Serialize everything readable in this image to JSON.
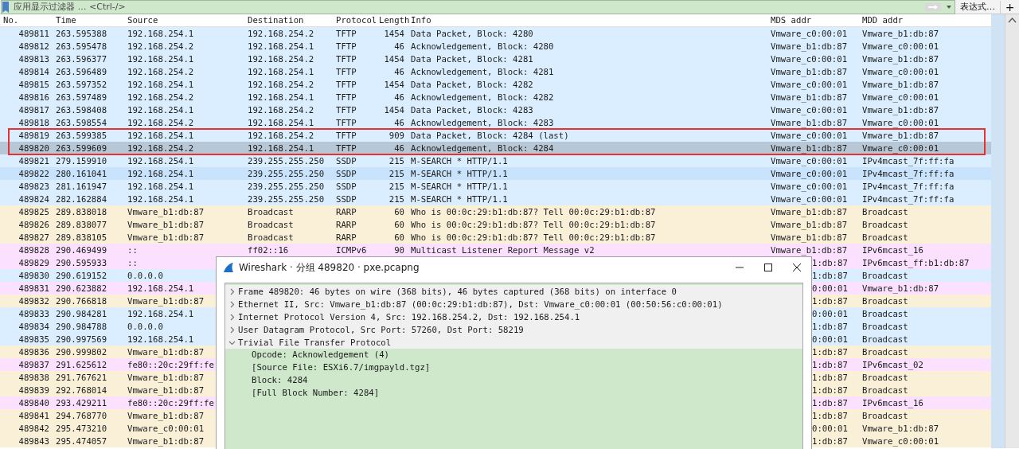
{
  "filter_bar": {
    "placeholder": "应用显示过滤器 … <Ctrl-/>",
    "buttons": [
      {
        "label": "表达式…",
        "kind": "expression"
      },
      {
        "label": "+",
        "kind": "add"
      }
    ]
  },
  "packet_list": {
    "columns": [
      "No.",
      "Time",
      "Source",
      "Destination",
      "Protocol",
      "Length",
      "Info",
      "MDS addr",
      "MDD addr"
    ],
    "rows": [
      {
        "kind": "full",
        "no": "489811",
        "time": "263.595388",
        "source": "192.168.254.1",
        "destination": "192.168.254.2",
        "protocol": "TFTP",
        "length": "1454",
        "info": "Data Packet, Block: 4280",
        "mds_addr": "Vmware_c0:00:01",
        "mdd_addr": "Vmware_b1:db:87",
        "color": "#daeeff",
        "selected": false,
        "marked": false
      },
      {
        "kind": "full",
        "no": "489812",
        "time": "263.595478",
        "source": "192.168.254.2",
        "destination": "192.168.254.1",
        "protocol": "TFTP",
        "length": "46",
        "info": "Acknowledgement, Block: 4280",
        "mds_addr": "Vmware_b1:db:87",
        "mdd_addr": "Vmware_c0:00:01",
        "color": "#daeeff",
        "selected": false,
        "marked": false
      },
      {
        "kind": "full",
        "no": "489813",
        "time": "263.596377",
        "source": "192.168.254.1",
        "destination": "192.168.254.2",
        "protocol": "TFTP",
        "length": "1454",
        "info": "Data Packet, Block: 4281",
        "mds_addr": "Vmware_c0:00:01",
        "mdd_addr": "Vmware_b1:db:87",
        "color": "#daeeff",
        "selected": false,
        "marked": false
      },
      {
        "kind": "full",
        "no": "489814",
        "time": "263.596489",
        "source": "192.168.254.2",
        "destination": "192.168.254.1",
        "protocol": "TFTP",
        "length": "46",
        "info": "Acknowledgement, Block: 4281",
        "mds_addr": "Vmware_b1:db:87",
        "mdd_addr": "Vmware_c0:00:01",
        "color": "#daeeff",
        "selected": false,
        "marked": false
      },
      {
        "kind": "full",
        "no": "489815",
        "time": "263.597352",
        "source": "192.168.254.1",
        "destination": "192.168.254.2",
        "protocol": "TFTP",
        "length": "1454",
        "info": "Data Packet, Block: 4282",
        "mds_addr": "Vmware_c0:00:01",
        "mdd_addr": "Vmware_b1:db:87",
        "color": "#daeeff",
        "selected": false,
        "marked": false
      },
      {
        "kind": "full",
        "no": "489816",
        "time": "263.597489",
        "source": "192.168.254.2",
        "destination": "192.168.254.1",
        "protocol": "TFTP",
        "length": "46",
        "info": "Acknowledgement, Block: 4282",
        "mds_addr": "Vmware_b1:db:87",
        "mdd_addr": "Vmware_c0:00:01",
        "color": "#daeeff",
        "selected": false,
        "marked": false
      },
      {
        "kind": "full",
        "no": "489817",
        "time": "263.598408",
        "source": "192.168.254.1",
        "destination": "192.168.254.2",
        "protocol": "TFTP",
        "length": "1454",
        "info": "Data Packet, Block: 4283",
        "mds_addr": "Vmware_c0:00:01",
        "mdd_addr": "Vmware_b1:db:87",
        "color": "#daeeff",
        "selected": false,
        "marked": false
      },
      {
        "kind": "full",
        "no": "489818",
        "time": "263.598554",
        "source": "192.168.254.2",
        "destination": "192.168.254.1",
        "protocol": "TFTP",
        "length": "46",
        "info": "Acknowledgement, Block: 4283",
        "mds_addr": "Vmware_b1:db:87",
        "mdd_addr": "Vmware_c0:00:01",
        "color": "#daeeff",
        "selected": false,
        "marked": false
      },
      {
        "kind": "full",
        "no": "489819",
        "time": "263.599385",
        "source": "192.168.254.1",
        "destination": "192.168.254.2",
        "protocol": "TFTP",
        "length": "909",
        "info": "Data Packet, Block: 4284 (last)",
        "mds_addr": "Vmware_c0:00:01",
        "mdd_addr": "Vmware_b1:db:87",
        "color": "#daeeff",
        "selected": false,
        "marked": true
      },
      {
        "kind": "full",
        "no": "489820",
        "time": "263.599609",
        "source": "192.168.254.2",
        "destination": "192.168.254.1",
        "protocol": "TFTP",
        "length": "46",
        "info": "Acknowledgement, Block: 4284",
        "mds_addr": "Vmware_b1:db:87",
        "mdd_addr": "Vmware_c0:00:01",
        "selected": true,
        "marked": true
      },
      {
        "kind": "full",
        "no": "489821",
        "time": "279.159910",
        "source": "192.168.254.1",
        "destination": "239.255.255.250",
        "protocol": "SSDP",
        "length": "215",
        "info": "M-SEARCH * HTTP/1.1",
        "mds_addr": "Vmware_c0:00:01",
        "mdd_addr": "IPv4mcast_7f:ff:fa",
        "color": "#daeeff",
        "selected": false,
        "marked": false
      },
      {
        "kind": "full",
        "no": "489822",
        "time": "280.161041",
        "source": "192.168.254.1",
        "destination": "239.255.255.250",
        "protocol": "SSDP",
        "length": "215",
        "info": "M-SEARCH * HTTP/1.1",
        "mds_addr": "Vmware_c0:00:01",
        "mdd_addr": "IPv4mcast_7f:ff:fa",
        "color": "#c8e3fb",
        "selected": false,
        "marked": false
      },
      {
        "kind": "full",
        "no": "489823",
        "time": "281.161947",
        "source": "192.168.254.1",
        "destination": "239.255.255.250",
        "protocol": "SSDP",
        "length": "215",
        "info": "M-SEARCH * HTTP/1.1",
        "mds_addr": "Vmware_c0:00:01",
        "mdd_addr": "IPv4mcast_7f:ff:fa",
        "color": "#daeeff",
        "selected": false,
        "marked": false
      },
      {
        "kind": "full",
        "no": "489824",
        "time": "282.162884",
        "source": "192.168.254.1",
        "destination": "239.255.255.250",
        "protocol": "SSDP",
        "length": "215",
        "info": "M-SEARCH * HTTP/1.1",
        "mds_addr": "Vmware_c0:00:01",
        "mdd_addr": "IPv4mcast_7f:ff:fa",
        "color": "#daeeff",
        "selected": false,
        "marked": false
      },
      {
        "kind": "full",
        "no": "489825",
        "time": "289.838018",
        "source": "Vmware_b1:db:87",
        "destination": "Broadcast",
        "protocol": "RARP",
        "length": "60",
        "info": "Who is 00:0c:29:b1:db:87? Tell 00:0c:29:b1:db:87",
        "mds_addr": "Vmware_b1:db:87",
        "mdd_addr": "Broadcast",
        "color": "#faf0d7",
        "selected": false,
        "marked": false
      },
      {
        "kind": "full",
        "no": "489826",
        "time": "289.838077",
        "source": "Vmware_b1:db:87",
        "destination": "Broadcast",
        "protocol": "RARP",
        "length": "60",
        "info": "Who is 00:0c:29:b1:db:87? Tell 00:0c:29:b1:db:87",
        "mds_addr": "Vmware_b1:db:87",
        "mdd_addr": "Broadcast",
        "color": "#faf0d7",
        "selected": false,
        "marked": false
      },
      {
        "kind": "full",
        "no": "489827",
        "time": "289.838105",
        "source": "Vmware_b1:db:87",
        "destination": "Broadcast",
        "protocol": "RARP",
        "length": "60",
        "info": "Who is 00:0c:29:b1:db:87? Tell 00:0c:29:b1:db:87",
        "mds_addr": "Vmware_b1:db:87",
        "mdd_addr": "Broadcast",
        "color": "#faf0d7",
        "selected": false,
        "marked": false
      },
      {
        "kind": "full",
        "no": "489828",
        "time": "290.469499",
        "source": "::",
        "destination": "ff02::16",
        "protocol": "ICMPv6",
        "length": "90",
        "info": "Multicast Listener Report Message v2",
        "mds_addr": "Vmware_b1:db:87",
        "mdd_addr": "IPv6mcast_16",
        "color": "#fce0ff",
        "selected": false,
        "marked": false
      },
      {
        "kind": "covered",
        "no": "489829",
        "time": "290.595933",
        "source": "::",
        "mds_addr": "1:db:87",
        "mdd_addr": "IPv6mcast_ff:b1:db:87",
        "color": "#fce0ff",
        "selected": false,
        "marked": false
      },
      {
        "kind": "covered",
        "no": "489830",
        "time": "290.619152",
        "source": "0.0.0.0",
        "mds_addr": "1:db:87",
        "mdd_addr": "Broadcast",
        "color": "#daeeff",
        "selected": false,
        "marked": false
      },
      {
        "kind": "covered",
        "no": "489831",
        "time": "290.623882",
        "source": "192.168.254.1",
        "mds_addr": "0:00:01",
        "mdd_addr": "Vmware_b1:db:87",
        "color": "#fce0ff",
        "selected": false,
        "marked": false
      },
      {
        "kind": "covered",
        "no": "489832",
        "time": "290.766818",
        "source": "Vmware_b1:db:87",
        "mds_addr": "1:db:87",
        "mdd_addr": "Broadcast",
        "color": "#faf0d7",
        "selected": false,
        "marked": false
      },
      {
        "kind": "covered",
        "no": "489833",
        "time": "290.984281",
        "source": "192.168.254.1",
        "mds_addr": "0:00:01",
        "mdd_addr": "Broadcast",
        "color": "#daeeff",
        "selected": false,
        "marked": false
      },
      {
        "kind": "covered",
        "no": "489834",
        "time": "290.984788",
        "source": "0.0.0.0",
        "mds_addr": "1:db:87",
        "mdd_addr": "Broadcast",
        "color": "#daeeff",
        "selected": false,
        "marked": false
      },
      {
        "kind": "covered",
        "no": "489835",
        "time": "290.997569",
        "source": "192.168.254.1",
        "mds_addr": "0:00:01",
        "mdd_addr": "Broadcast",
        "color": "#daeeff",
        "selected": false,
        "marked": false
      },
      {
        "kind": "covered",
        "no": "489836",
        "time": "290.999802",
        "source": "Vmware_b1:db:87",
        "mds_addr": "1:db:87",
        "mdd_addr": "Broadcast",
        "color": "#faf0d7",
        "selected": false,
        "marked": false
      },
      {
        "kind": "covered",
        "no": "489837",
        "time": "291.625612",
        "source": "fe80::20c:29ff:fe",
        "mds_addr": "1:db:87",
        "mdd_addr": "IPv6mcast_02",
        "color": "#fce0ff",
        "selected": false,
        "marked": false
      },
      {
        "kind": "covered",
        "no": "489838",
        "time": "291.767621",
        "source": "Vmware_b1:db:87",
        "mds_addr": "1:db:87",
        "mdd_addr": "Broadcast",
        "color": "#faf0d7",
        "selected": false,
        "marked": false
      },
      {
        "kind": "covered",
        "no": "489839",
        "time": "292.768014",
        "source": "Vmware_b1:db:87",
        "mds_addr": "1:db:87",
        "mdd_addr": "Broadcast",
        "color": "#faf0d7",
        "selected": false,
        "marked": false
      },
      {
        "kind": "covered",
        "no": "489840",
        "time": "293.429211",
        "source": "fe80::20c:29ff:fe",
        "mds_addr": "1:db:87",
        "mdd_addr": "IPv6mcast_16",
        "color": "#fce0ff",
        "selected": false,
        "marked": false
      },
      {
        "kind": "covered",
        "no": "489841",
        "time": "294.768770",
        "source": "Vmware_b1:db:87",
        "mds_addr": "1:db:87",
        "mdd_addr": "Broadcast",
        "color": "#faf0d7",
        "selected": false,
        "marked": false
      },
      {
        "kind": "covered",
        "no": "489842",
        "time": "295.473210",
        "source": "Vmware_c0:00:01",
        "mds_addr": "0:00:01",
        "mdd_addr": "Vmware_b1:db:87",
        "color": "#faf0d7",
        "selected": false,
        "marked": false
      },
      {
        "kind": "covered",
        "no": "489843",
        "time": "295.474057",
        "source": "Vmware_b1:db:87",
        "mds_addr": "1:db:87",
        "mdd_addr": "Vmware_c0:00:01",
        "color": "#faf0d7",
        "selected": false,
        "marked": false
      }
    ]
  },
  "packet_dialog": {
    "title": "Wireshark · 分组 489820 · pxe.pcapng",
    "tree": [
      {
        "text": "Frame 489820: 46 bytes on wire (368 bits), 46 bytes captured (368 bits) on interface 0",
        "expanded": false
      },
      {
        "text": "Ethernet II, Src: Vmware_b1:db:87 (00:0c:29:b1:db:87), Dst: Vmware_c0:00:01 (00:50:56:c0:00:01)",
        "expanded": false
      },
      {
        "text": "Internet Protocol Version 4, Src: 192.168.254.2, Dst: 192.168.254.1",
        "expanded": false
      },
      {
        "text": "User Datagram Protocol, Src Port: 57260, Dst Port: 58219",
        "expanded": false
      },
      {
        "text": "Trivial File Transfer Protocol",
        "expanded": true,
        "children": [
          {
            "text": "Opcode: Acknowledgement (4)"
          },
          {
            "text": "[Source File: ESXi6.7/imgpayld.tgz]"
          },
          {
            "text": "Block: 4284"
          },
          {
            "text": "[Full Block Number: 4284]"
          }
        ]
      }
    ]
  }
}
